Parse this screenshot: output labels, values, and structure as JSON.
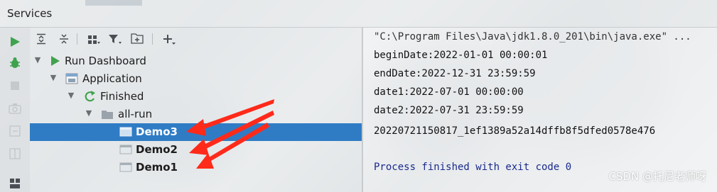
{
  "header": {
    "title": "Services"
  },
  "toolbar": {
    "icons": [
      "expand-all-icon",
      "collapse-all-icon",
      "group-icon",
      "filter-icon",
      "new-group-icon",
      "add-icon"
    ]
  },
  "tree": [
    {
      "label": "Run Dashboard",
      "level": 1,
      "icon": "run-icon"
    },
    {
      "label": "Application",
      "level": 2,
      "icon": "application-icon"
    },
    {
      "label": "Finished",
      "level": 3,
      "icon": "rerun-icon"
    },
    {
      "label": "all-run",
      "level": 4,
      "icon": "folder-icon"
    },
    {
      "label": "Demo3",
      "level": 5,
      "icon": "app-window-icon",
      "selected": true
    },
    {
      "label": "Demo2",
      "level": 5,
      "icon": "app-window-icon"
    },
    {
      "label": "Demo1",
      "level": 5,
      "icon": "app-window-icon"
    }
  ],
  "console": {
    "command": "\"C:\\Program Files\\Java\\jdk1.8.0_201\\bin\\java.exe\" ...",
    "lines": [
      "beginDate:2022-01-01 00:00:01",
      "endDate:2022-12-31 23:59:59",
      "date1:2022-07-01 00:00:00",
      "date2:2022-07-31 23:59:59",
      "20220721150817_1ef1389a52a14dffb8f5dfed0578e476"
    ],
    "exit": "Process finished with exit code 0"
  },
  "watermark": "CSDN @托尼老师呀",
  "colors": {
    "selection": "#2f7cc5",
    "run_green": "#3fa34d",
    "annotation_red": "#ff2a1a"
  }
}
